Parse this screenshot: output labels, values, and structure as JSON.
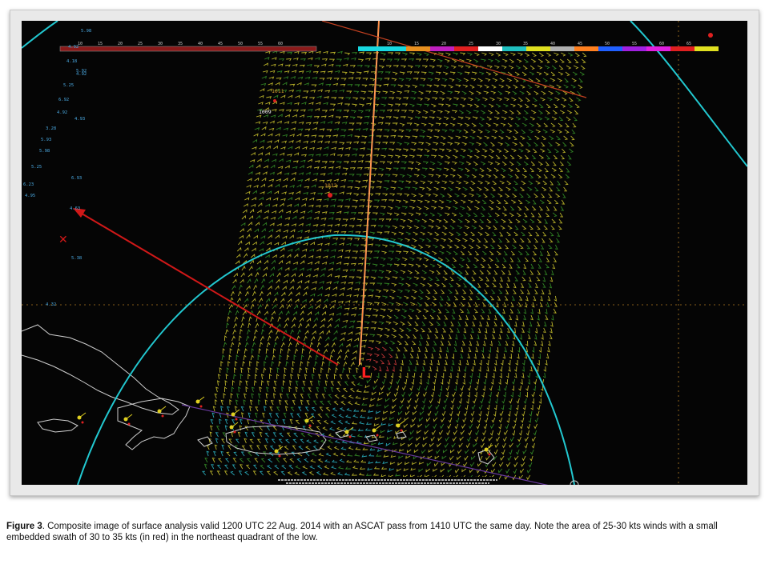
{
  "caption": {
    "label": "Figure 3",
    "text": ". Composite image of surface analysis valid 1200 UTC 22 Aug. 2014 with an ASCAT pass from 1410 UTC  the same day. Note the area of 25-30 kts winds with a small embedded swath of 30 to 35 kts (in red) in the northeast quadrant of the low."
  },
  "colors": {
    "background": "#050505",
    "frame": "#e9e9e9",
    "coast": "#d0d0d0",
    "boundary": "#22c8d0",
    "track": "#ff9a40",
    "arrow": "#d01818",
    "barb_low": "#2ec0d0",
    "barb_mid": "#3a9a2a",
    "barb_high": "#d8d030",
    "barb_max": "#e04040"
  },
  "map": {
    "legend_left": [
      "10",
      "15",
      "20",
      "25",
      "30",
      "35",
      "40",
      "45",
      "50",
      "55",
      "60"
    ],
    "legend_right": [
      "10",
      "15",
      "20",
      "25",
      "30",
      "35",
      "40",
      "45",
      "50",
      "55",
      "60",
      "65"
    ],
    "pressure_labels": [
      "1009",
      "1011",
      "1012"
    ],
    "low_symbol": "L",
    "x_symbol": "✕",
    "side_values": [
      "5.98",
      "4.92",
      "4.18",
      "5.92",
      "4.92",
      "5.25",
      "6.92",
      "4.92",
      "4.93",
      "3.28",
      "5.93",
      "5.98",
      "5.25",
      "6.93",
      "6.23",
      "4.95",
      "4.63",
      "5.38",
      "4.32"
    ]
  }
}
